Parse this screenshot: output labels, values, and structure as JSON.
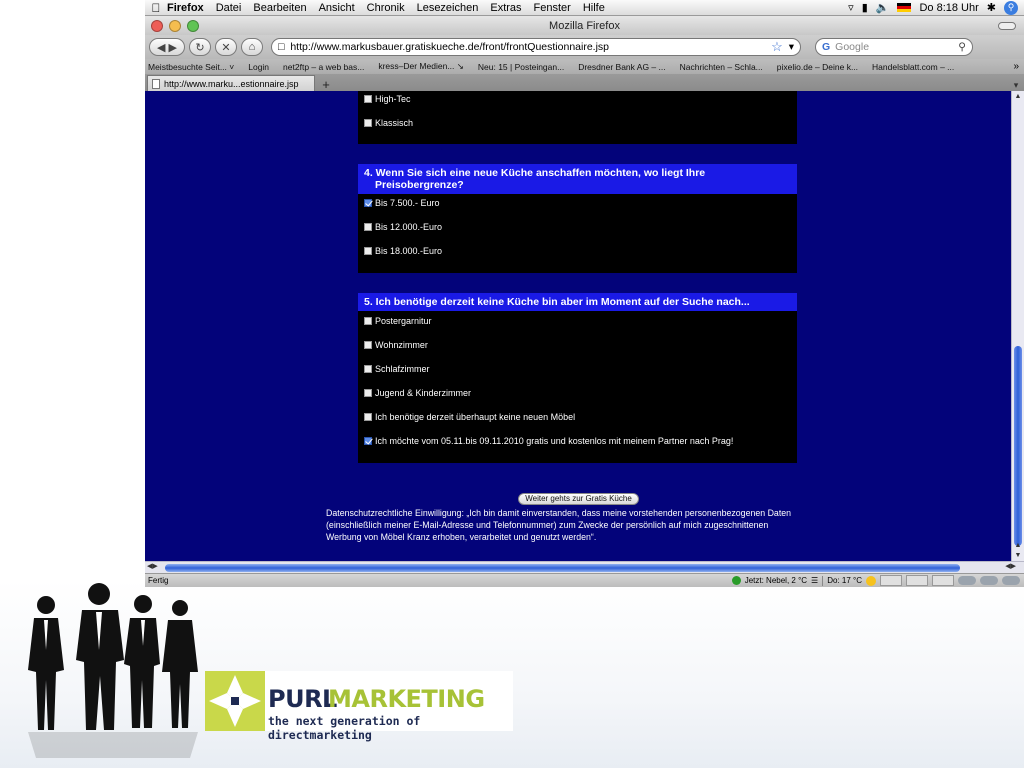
{
  "menubar": {
    "items": [
      "Firefox",
      "Datei",
      "Bearbeiten",
      "Ansicht",
      "Chronik",
      "Lesezeichen",
      "Extras",
      "Fenster",
      "Hilfe"
    ],
    "clock": "Do 8:18 Uhr"
  },
  "window": {
    "title": "Mozilla Firefox"
  },
  "navbar": {
    "url": "http://www.markusbauer.gratiskueche.de/front/frontQuestionnaire.jsp",
    "search_placeholder": "Google"
  },
  "bookmarks": [
    "Meistbesuchte Seit... ˅",
    "Login",
    "net2ftp – a web bas...",
    "kress–Der Medien... ↘",
    "Neu: 15 | Posteingan...",
    "Dresdner Bank AG – ...",
    "Nachrichten – Schla...",
    "pixelio.de – Deine k...",
    "Handelsblatt.com – ..."
  ],
  "tab": {
    "label": "http://www.marku...estionnaire.jsp"
  },
  "questionnaire": {
    "prev_options": [
      {
        "label": "High-Tec",
        "checked": false
      },
      {
        "label": "Klassisch",
        "checked": false
      }
    ],
    "q4": {
      "title_line1": "4. Wenn Sie sich eine neue Küche anschaffen möchten, wo liegt Ihre",
      "title_line2": "Preisobergrenze?",
      "options": [
        {
          "label": "Bis 7.500.- Euro",
          "checked": true
        },
        {
          "label": "Bis 12.000.-Euro",
          "checked": false
        },
        {
          "label": "Bis 18.000.-Euro",
          "checked": false
        }
      ]
    },
    "q5": {
      "title": "5. Ich benötige derzeit keine Küche bin aber im Moment auf der Suche nach...",
      "options": [
        {
          "label": "Postergarnitur",
          "checked": false
        },
        {
          "label": "Wohnzimmer",
          "checked": false
        },
        {
          "label": "Schlafzimmer",
          "checked": false
        },
        {
          "label": "Jugend & Kinderzimmer",
          "checked": false
        },
        {
          "label": "Ich benötige derzeit überhaupt keine neuen Möbel",
          "checked": false
        },
        {
          "label": "Ich möchte vom 05.11.bis 09.11.2010 gratis und kostenlos mit meinem Partner nach Prag!",
          "checked": true
        }
      ]
    },
    "submit_label": "Weiter gehts zur Gratis Küche",
    "consent_lines": [
      "Datenschutzrechtliche Einwilligung: „Ich bin damit einverstanden, dass meine vorstehenden personenbezogenen Daten",
      "(einschließlich meiner E-Mail-Adresse und Telefonnummer) zum Zwecke der persönlich auf mich zugeschnittenen",
      "Werbung von Möbel Kranz erhoben, verarbeitet und genutzt werden“."
    ]
  },
  "statusbar": {
    "status": "Fertig",
    "weather_now": "Jetzt: Nebel, 2 °C",
    "weather_day": "Do: 17 °C"
  },
  "logo": {
    "brand_part1": "PURL",
    "brand_part2": "MARKETING",
    "tagline": "the next generation of directmarketing"
  },
  "colors": {
    "page_bg": "#03037a",
    "question_header": "#1a1ae6",
    "panel": "#000000",
    "logo_green": "#a7c236",
    "logo_navy": "#1e2a52"
  }
}
